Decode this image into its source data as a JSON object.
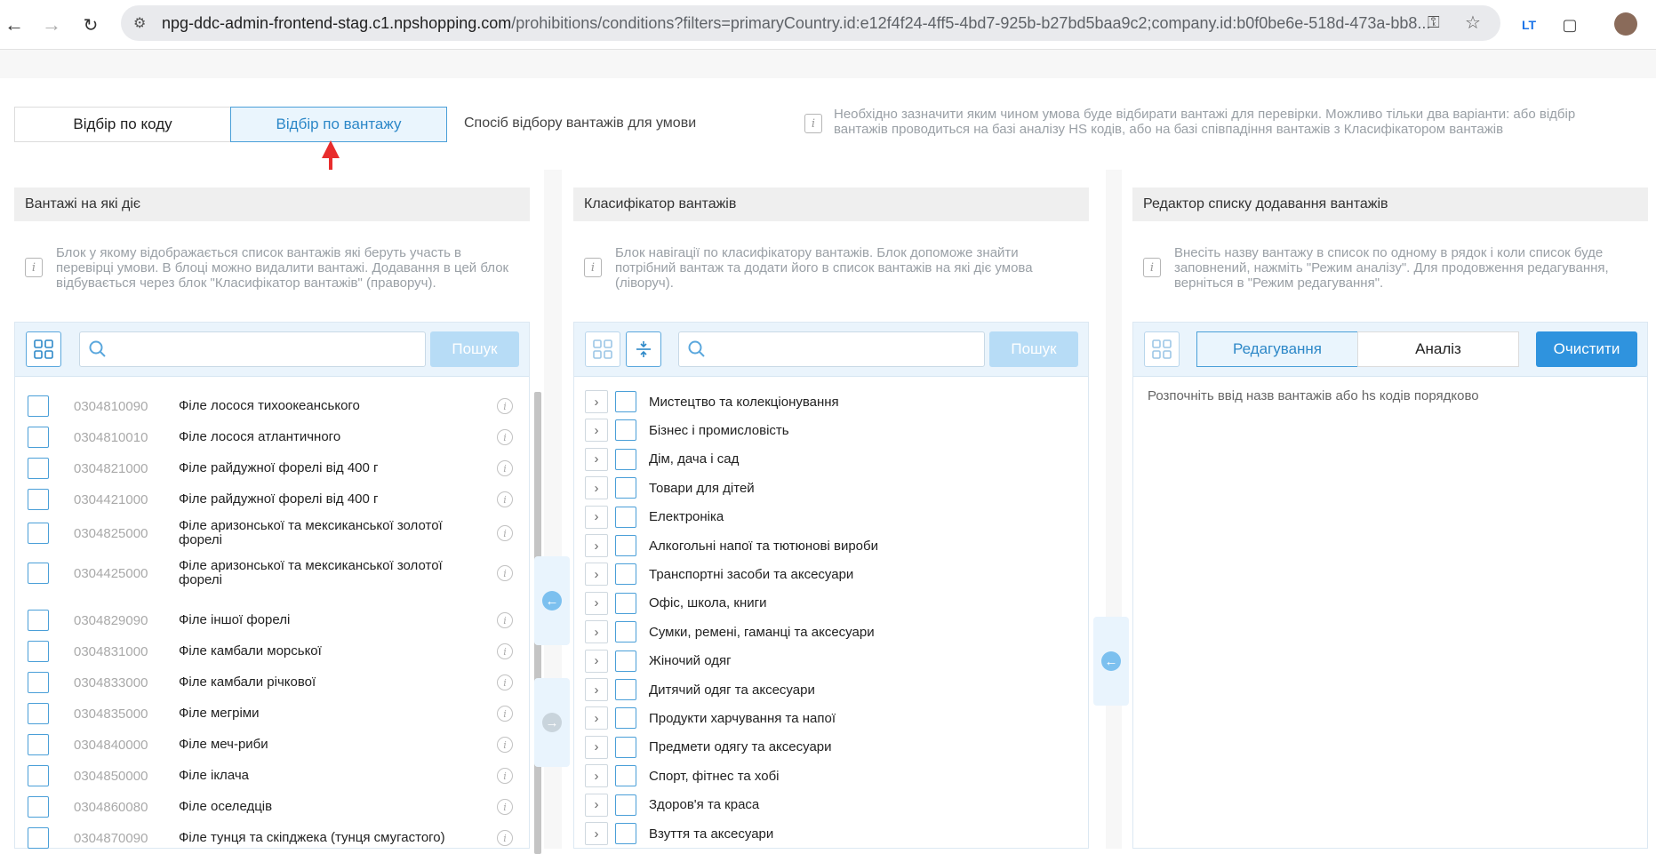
{
  "browser": {
    "url_host": "npg-ddc-admin-frontend-stag.c1.npshopping.com",
    "url_path": "/prohibitions/conditions?filters=primaryCountry.id:e12f4f24-4ff5-4bd7-925b-b27bd5baa9c2;company.id:b0f0be6e-518d-473a-bb8...",
    "ext_label": "LT"
  },
  "mode": {
    "option_code": "Відбір по коду",
    "option_cargo": "Відбір по вантажу",
    "selected": "Відбір по вантажу",
    "label": "Спосіб відбору вантажів для умови",
    "hint": "Необхідно зазначити яким чином умова буде відбирати вантажі для перевірки. Можливо тільки два варіанти: або відбір вантажів проводиться на базі аналізу HS кодів, або на базі співпадіння вантажів з Класифікатором вантажів"
  },
  "left": {
    "title": "Вантажі на які діє",
    "hint": "Блок у якому відображається список вантажів які беруть участь в перевірці умови. В блоці можно видалити вантажі. Додавання в цей блок відбувається через блок \"Класифікатор вантажів\" (праворуч).",
    "search_button": "Пошук",
    "search_placeholder": "",
    "items": [
      {
        "code": "0304810090",
        "name": "Філе лосося тихоокеанського"
      },
      {
        "code": "0304810010",
        "name": "Філе лосося атлантичного"
      },
      {
        "code": "0304821000",
        "name": "Філе райдужної форелі від 400 г"
      },
      {
        "code": "0304421000",
        "name": "Філе райдужної форелі від 400 г"
      },
      {
        "code": "0304825000",
        "name": "Філе аризонської та мексиканської золотої форелі"
      },
      {
        "code": "0304425000",
        "name": "Філе аризонської та мексиканської золотої форелі"
      },
      {
        "code": "0304829090",
        "name": "Філе іншої форелі"
      },
      {
        "code": "0304831000",
        "name": "Філе камбали морської"
      },
      {
        "code": "0304833000",
        "name": "Філе камбали річкової"
      },
      {
        "code": "0304835000",
        "name": "Філе мегріми"
      },
      {
        "code": "0304840000",
        "name": "Філе меч-риби"
      },
      {
        "code": "0304850000",
        "name": "Філе іклача"
      },
      {
        "code": "0304860080",
        "name": "Філе оселедців"
      },
      {
        "code": "0304870090",
        "name": "Філе тунця та скіпджека (тунця смугастого)"
      }
    ]
  },
  "middle": {
    "title": "Класифікатор вантажів",
    "hint": "Блок навігації по класифікатору вантажів. Блок допоможе знайти потрібний вантаж та додати його в список вантажів на які діє умова (ліворуч).",
    "search_button": "Пошук",
    "items": [
      "Мистецтво та колекціонування",
      "Бізнес і промисловість",
      "Дім, дача і сад",
      "Товари для дітей",
      "Електроніка",
      "Алкогольні напої та тютюнові вироби",
      "Транспортні засоби та аксесуари",
      "Офіс, школа, книги",
      "Сумки, ремені, гаманці та аксесуари",
      "Жіночий одяг",
      "Дитячий одяг та аксесуари",
      "Продукти харчування та напої",
      "Предмети одягу та аксесуари",
      "Спорт, фітнес та хобі",
      "Здоров'я та краса",
      "Взуття та аксесуари"
    ]
  },
  "right": {
    "title": "Редактор списку додавання вантажів",
    "hint": "Внесіть назву вантажу в список по одному в рядок і коли список буде заповнений, нажміть \"Режим аналізу\". Для продовження редагування, верніться в \"Режим редагування\".",
    "tab_edit": "Редагування",
    "tab_analysis": "Аналіз",
    "clear_button": "Очистити",
    "editor_placeholder": "Розпочніть ввід назв вантажів або hs кодів порядково"
  },
  "colors": {
    "accent": "#2f93de",
    "arrow": "#e82d2d"
  }
}
